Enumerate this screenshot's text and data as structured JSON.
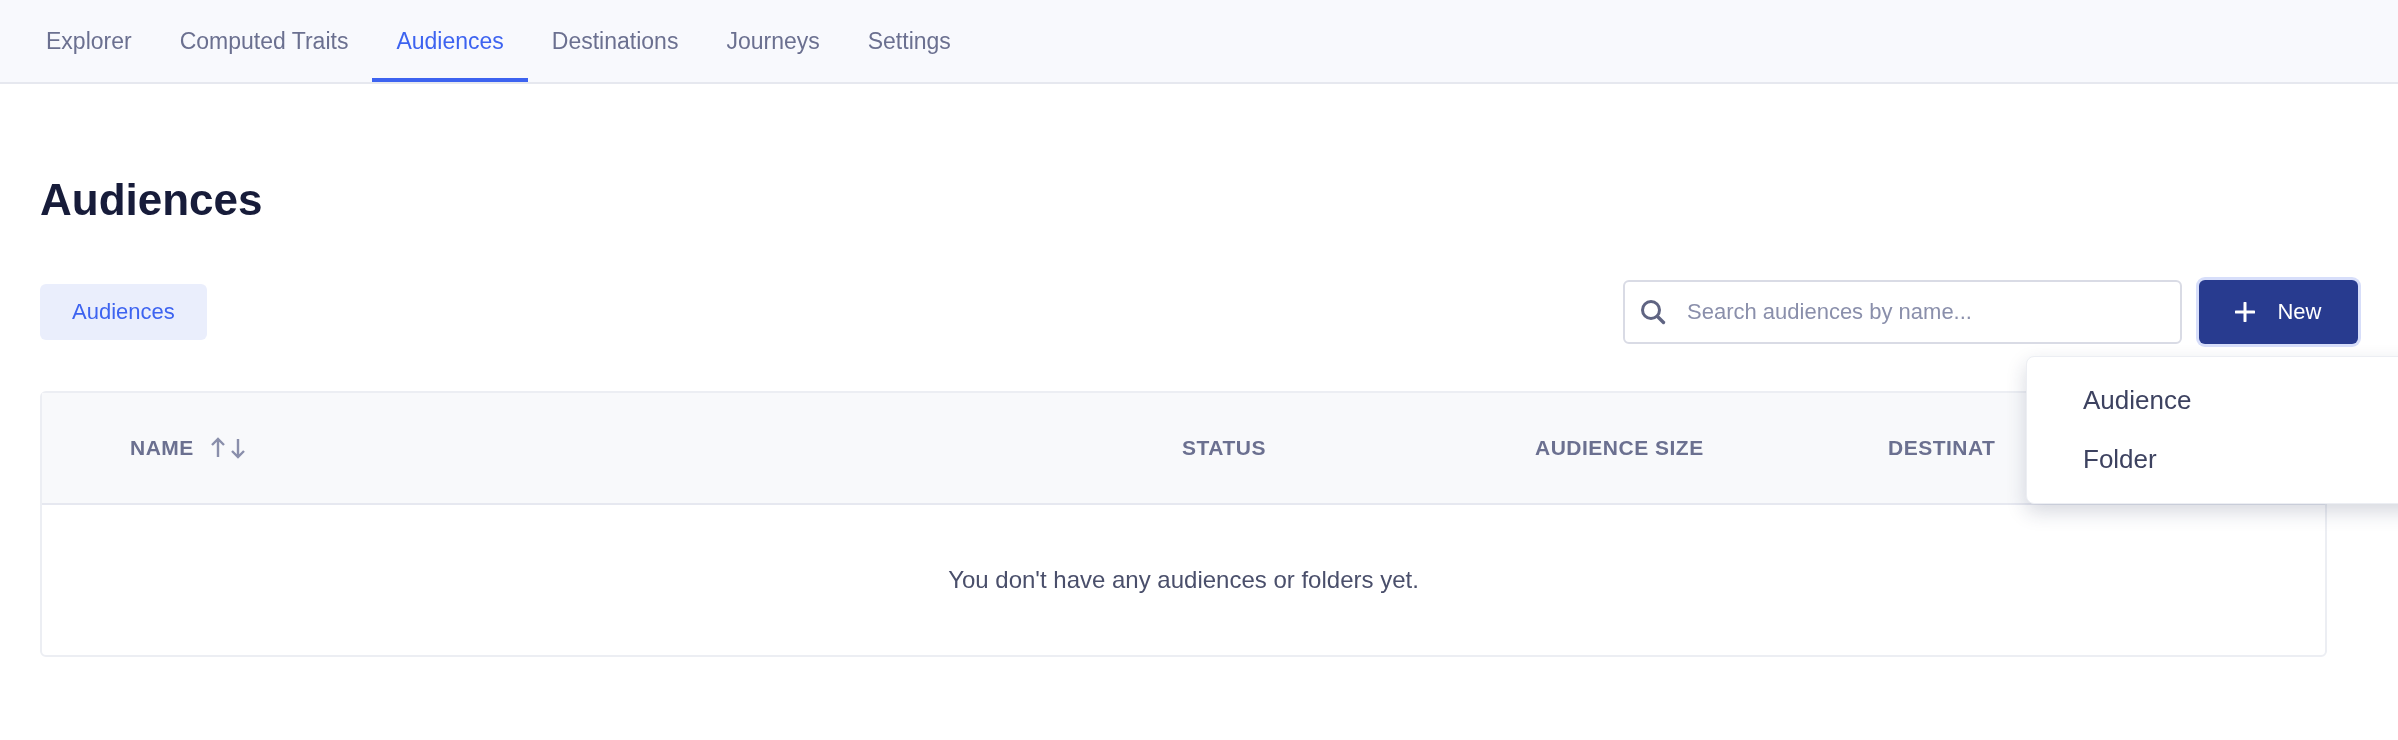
{
  "tabs": [
    {
      "label": "Explorer",
      "selected": false
    },
    {
      "label": "Computed Traits",
      "selected": false
    },
    {
      "label": "Audiences",
      "selected": true
    },
    {
      "label": "Destinations",
      "selected": false
    },
    {
      "label": "Journeys",
      "selected": false
    },
    {
      "label": "Settings",
      "selected": false
    }
  ],
  "page_title": "Audiences",
  "filter_chips": [
    {
      "label": "Audiences",
      "selected": true
    }
  ],
  "search": {
    "placeholder": "Search audiences by name..."
  },
  "new_button": {
    "label": "New"
  },
  "new_menu": {
    "items": [
      "Audience",
      "Folder"
    ]
  },
  "table": {
    "columns": [
      {
        "label": "NAME",
        "sortable": true
      },
      {
        "label": "STATUS",
        "sortable": false
      },
      {
        "label": "AUDIENCE SIZE",
        "sortable": false
      },
      {
        "label": "DESTINAT",
        "sortable": false
      }
    ],
    "empty_message": "You don't have any audiences or folders yet."
  }
}
